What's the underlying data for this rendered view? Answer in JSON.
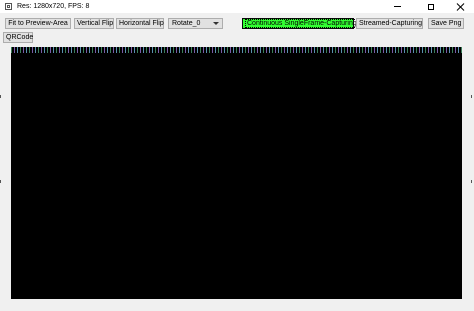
{
  "window": {
    "title": "Res: 1280x720, FPS: 8"
  },
  "toolbar": {
    "fit_label": "Fit to Preview-Area",
    "vflip_label": "Vertical Flip",
    "hflip_label": "Horizontal Flip",
    "rotate_value": "Rotate_0",
    "continuous_label": "Continuous SingleFrame-Capturing",
    "streamed_label": "Streamed-Capturing",
    "save_label": "Save Png",
    "qrcode_label": "QRCode"
  },
  "colors": {
    "active_button": "#33ff33",
    "preview_background": "#000000"
  },
  "icons": {
    "app": "app-window-icon",
    "minimize": "minimize-icon",
    "maximize": "maximize-icon",
    "close": "close-icon"
  }
}
